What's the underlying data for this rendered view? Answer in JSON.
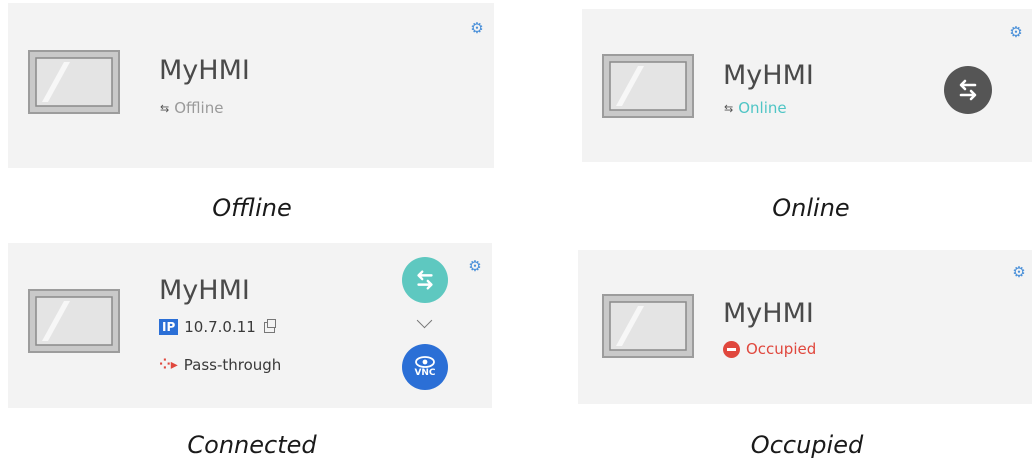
{
  "colors": {
    "card_bg": "#f3f3f3",
    "gear": "#4a90d9",
    "online": "#4fc5c5",
    "offline": "#9a9a9a",
    "occupied": "#e0473d",
    "vnc": "#2b6fd6",
    "passthrough": "#e0473d",
    "online_button": "#555555",
    "connected_button": "#5ec8c0"
  },
  "cards": [
    {
      "device_name": "MyHMI",
      "status_text": "Offline",
      "caption": "Offline",
      "icons": [
        "monitor-icon",
        "link-icon",
        "gear-icon"
      ]
    },
    {
      "device_name": "MyHMI",
      "status_text": "Online",
      "caption": "Online",
      "icons": [
        "monitor-icon",
        "link-icon",
        "gear-icon",
        "connect-arrows-icon"
      ]
    },
    {
      "device_name": "MyHMI",
      "ip_badge": "IP",
      "ip_address": "10.7.0.11",
      "mode_text": "Pass-through",
      "vnc_label": "VNC",
      "caption": "Connected",
      "icons": [
        "monitor-icon",
        "ip-icon",
        "copy-icon",
        "passthrough-icon",
        "gear-icon",
        "connect-arrows-icon",
        "chevron-down-icon",
        "vnc-eye-icon"
      ]
    },
    {
      "device_name": "MyHMI",
      "status_text": "Occupied",
      "caption": "Occupied",
      "icons": [
        "monitor-icon",
        "occupied-icon",
        "gear-icon"
      ]
    }
  ]
}
